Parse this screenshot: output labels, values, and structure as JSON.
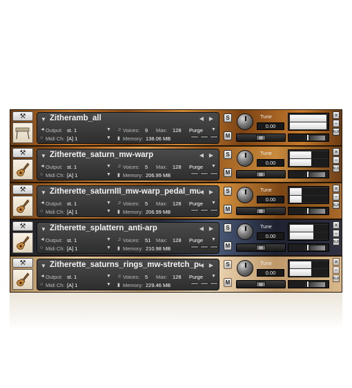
{
  "rack": {
    "slots": [
      {
        "name": "Zitheramb_all",
        "output": "st. 1",
        "midi": "[A]  1",
        "voices": "9",
        "max": "128",
        "purge": "Purge",
        "memory": "138.06 MB",
        "tune_label": "Tune",
        "tune_value": "0.00",
        "level_top": 0.95,
        "level_bottom": 0.95,
        "solo": "S",
        "mute": "M",
        "aux": "AUX"
      },
      {
        "name": "Zitherette_saturn_mw-warp",
        "output": "st. 1",
        "midi": "[A]  1",
        "voices": "5",
        "max": "128",
        "purge": "Purge",
        "memory": "206.99 MB",
        "tune_label": "Tune",
        "tune_value": "0.00",
        "level_top": 0.55,
        "level_bottom": 0.55,
        "solo": "S",
        "mute": "M",
        "aux": "AUX"
      },
      {
        "name": "Zitherette_saturnIII_mw-warp_pedal_mute",
        "output": "st. 1",
        "midi": "[A]  1",
        "voices": "5",
        "max": "128",
        "purge": "Purge",
        "memory": "206.99 MB",
        "tune_label": "Tune",
        "tune_value": "0.00",
        "level_top": 0.3,
        "level_bottom": 0.3,
        "solo": "S",
        "mute": "M",
        "aux": "AUX"
      },
      {
        "name": "Zitherette_splattern_anti-arp",
        "output": "st. 1",
        "midi": "[A]  1",
        "voices": "51",
        "max": "128",
        "purge": "Purge",
        "memory": "210.98 MB",
        "tune_label": "Tune",
        "tune_value": "0.00",
        "level_top": 0.6,
        "level_bottom": 0.6,
        "solo": "S",
        "mute": "M",
        "aux": "AUX"
      },
      {
        "name": "Zitherette_saturns_rings_mw-stretch_pedal_(",
        "output": "st. 1",
        "midi": "[A]  1",
        "voices": "5",
        "max": "128",
        "purge": "Purge",
        "memory": "229.46 MB",
        "tune_label": "Tune",
        "tune_value": "0.00",
        "level_top": 0.55,
        "level_bottom": 0.55,
        "solo": "S",
        "mute": "M",
        "aux": "AUX"
      }
    ]
  },
  "labels": {
    "output": "Output:",
    "midi": "Midi Ch:",
    "voices": "Voices:",
    "max": "Max:",
    "memory": "Memory:"
  },
  "icons": {
    "wrench": "wrench-icon",
    "instrument": "guitar-icon",
    "knob": "tune-knob"
  },
  "colors": {
    "panel": "#3a3a3a",
    "text": "#e8e8e8"
  }
}
